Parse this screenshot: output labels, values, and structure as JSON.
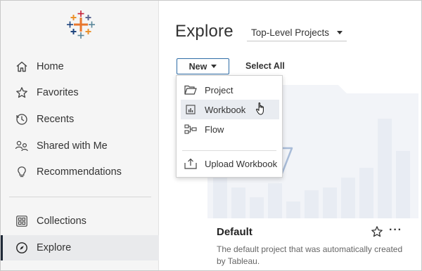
{
  "sidebar": {
    "logo_icon": "tableau-logo-icon",
    "items": [
      {
        "label": "Home",
        "icon": "home-icon"
      },
      {
        "label": "Favorites",
        "icon": "star-icon"
      },
      {
        "label": "Recents",
        "icon": "clock-icon"
      },
      {
        "label": "Shared with Me",
        "icon": "shared-users-icon"
      },
      {
        "label": "Recommendations",
        "icon": "lightbulb-icon"
      },
      {
        "label": "Collections",
        "icon": "collections-icon"
      },
      {
        "label": "Explore",
        "icon": "compass-icon",
        "active": true
      }
    ]
  },
  "header": {
    "title": "Explore",
    "project_filter": "Top-Level Projects"
  },
  "toolbar": {
    "new_label": "New",
    "select_all_label": "Select All"
  },
  "new_menu": {
    "items": [
      {
        "label": "Project",
        "icon": "folder-open-icon"
      },
      {
        "label": "Workbook",
        "icon": "workbook-icon",
        "hovered": true
      },
      {
        "label": "Flow",
        "icon": "flow-icon"
      },
      {
        "label": "Upload Workbook",
        "icon": "upload-icon"
      }
    ]
  },
  "project_card": {
    "title": "Default",
    "description": "The default project that was automatically created by Tableau."
  },
  "colors": {
    "sidebar_bg": "#f5f5f5",
    "active_bg": "#e9eaec",
    "button_border": "#2e6ca6",
    "menu_hover": "#e9ecf1",
    "card_art": "#eef1f6",
    "folder_stroke": "#a9bcd8"
  }
}
